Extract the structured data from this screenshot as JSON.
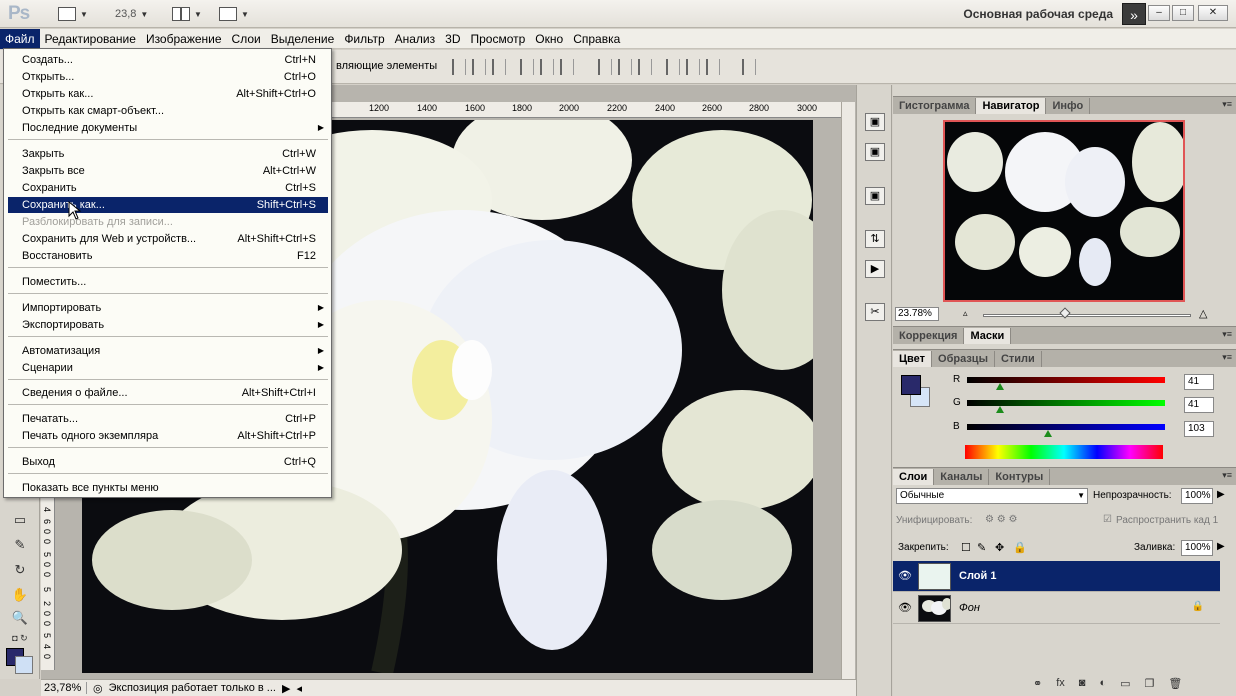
{
  "app": {
    "logo": "Ps",
    "zoom": "23,8",
    "workspace": "Основная рабочая среда"
  },
  "menubar": [
    "Файл",
    "Редактирование",
    "Изображение",
    "Слои",
    "Выделение",
    "Фильтр",
    "Анализ",
    "3D",
    "Просмотр",
    "Окно",
    "Справка"
  ],
  "options": {
    "text": "вляющие элементы"
  },
  "file_menu": {
    "items": [
      {
        "label": "Создать...",
        "shortcut": "Ctrl+N"
      },
      {
        "label": "Открыть...",
        "shortcut": "Ctrl+O"
      },
      {
        "label": "Открыть как...",
        "shortcut": "Alt+Shift+Ctrl+O"
      },
      {
        "label": "Открыть как смарт-объект...",
        "shortcut": ""
      },
      {
        "label": "Последние документы",
        "shortcut": ""
      },
      {
        "label": "Закрыть",
        "shortcut": "Ctrl+W"
      },
      {
        "label": "Закрыть все",
        "shortcut": "Alt+Ctrl+W"
      },
      {
        "label": "Сохранить",
        "shortcut": "Ctrl+S"
      },
      {
        "label": "Сохранить как...",
        "shortcut": "Shift+Ctrl+S"
      },
      {
        "label": "Разблокировать для записи...",
        "shortcut": ""
      },
      {
        "label": "Сохранить для Web и устройств...",
        "shortcut": "Alt+Shift+Ctrl+S"
      },
      {
        "label": "Восстановить",
        "shortcut": "F12"
      },
      {
        "label": "Поместить...",
        "shortcut": ""
      },
      {
        "label": "Импортировать",
        "shortcut": ""
      },
      {
        "label": "Экспортировать",
        "shortcut": ""
      },
      {
        "label": "Автоматизация",
        "shortcut": ""
      },
      {
        "label": "Сценарии",
        "shortcut": ""
      },
      {
        "label": "Сведения о файле...",
        "shortcut": "Alt+Shift+Ctrl+I"
      },
      {
        "label": "Печатать...",
        "shortcut": "Ctrl+P"
      },
      {
        "label": "Печать одного экземпляра",
        "shortcut": "Alt+Shift+Ctrl+P"
      },
      {
        "label": "Выход",
        "shortcut": "Ctrl+Q"
      },
      {
        "label": "Показать все пункты меню",
        "shortcut": ""
      }
    ]
  },
  "ruler": [
    "1200",
    "1400",
    "1600",
    "1800",
    "2000",
    "2200",
    "2400",
    "2600",
    "2800",
    "3000"
  ],
  "ruler_v": [
    "4",
    "6",
    "0",
    "0",
    "5",
    "0",
    "0",
    "5",
    "2",
    "0",
    "0",
    "5",
    "4",
    "0",
    "0"
  ],
  "status": {
    "zoom": "23,78%",
    "message": "Экспозиция работает только в ..."
  },
  "panels": {
    "top_tabs": [
      "Гистограмма",
      "Навигатор",
      "Инфо"
    ],
    "nav_zoom": "23.78%",
    "mid_tabs": [
      "Коррекция",
      "Маски"
    ],
    "color_tabs": [
      "Цвет",
      "Образцы",
      "Стили"
    ],
    "color": {
      "r_label": "R",
      "g_label": "G",
      "b_label": "B",
      "r": "41",
      "g": "41",
      "b": "103"
    },
    "layer_tabs": [
      "Слои",
      "Каналы",
      "Контуры"
    ],
    "blend_mode": "Обычные",
    "opacity_label": "Непрозрачность:",
    "opacity": "100%",
    "unify_label": "Унифицировать:",
    "propagate_label": "Распространить кад 1",
    "lock_label": "Закрепить:",
    "fill_label": "Заливка:",
    "fill": "100%",
    "layers": [
      {
        "name": "Слой 1",
        "selected": true
      },
      {
        "name": "Фон",
        "selected": false
      }
    ]
  },
  "colors": {
    "accent": "#0a246a",
    "foreground": "#29296a"
  }
}
